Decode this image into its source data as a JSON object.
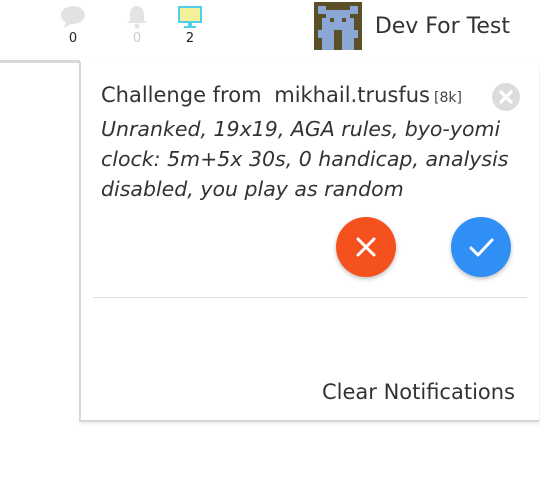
{
  "header": {
    "counters": [
      {
        "icon": "chat-bubble-icon",
        "count": "0"
      },
      {
        "icon": "bell-icon",
        "count": "0"
      },
      {
        "icon": "monitor-icon",
        "count": "2"
      }
    ],
    "username": "Dev For Test"
  },
  "notification": {
    "title_prefix": "Challenge from",
    "challenger": "mikhail.trusfus",
    "rank": "[8k]",
    "details": "Unranked, 19x19, AGA rules, byo-yomi clock: 5m+5x 30s, 0 handicap, analysis disabled, you play as random"
  },
  "footer": {
    "clear_label": "Clear Notifications"
  },
  "colors": {
    "decline": "#f4511e",
    "accept": "#2f8ff5",
    "monitor_border": "#4fd0e8",
    "monitor_fill": "#f3f19a"
  }
}
